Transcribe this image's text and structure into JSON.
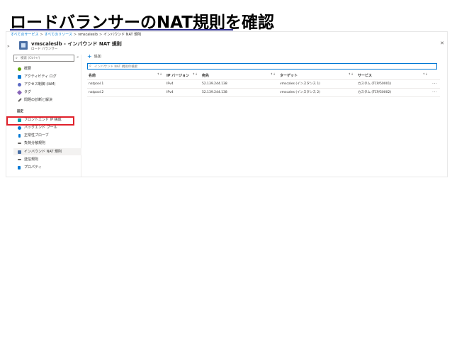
{
  "slide": {
    "title": "ロードバランサーのNAT規則を確認"
  },
  "breadcrumb": {
    "items": [
      "すべてのサービス",
      "すべてのリソース",
      "vmscaleslb",
      "インバウンド NAT 規則"
    ],
    "separator": ">"
  },
  "resource": {
    "title": "vmscaleslb - インバウンド NAT 規則",
    "subtitle": "ロード バランサー"
  },
  "sidebar": {
    "search_placeholder": "検索 (Ctrl+/)",
    "collapse_glyph": "«",
    "items": [
      {
        "label": "概要",
        "icon": "overview-icon",
        "color": "#5ba300"
      },
      {
        "label": "アクティビティ ログ",
        "icon": "activity-log-icon",
        "color": "#0078d4"
      },
      {
        "label": "アクセス制御 (IAM)",
        "icon": "iam-icon",
        "color": "#5c6ac4"
      },
      {
        "label": "タグ",
        "icon": "tag-icon",
        "color": "#8764b8"
      },
      {
        "label": "問題の診断と解決",
        "icon": "wrench-icon",
        "color": "#605e5c"
      }
    ],
    "section": "設定",
    "settings_items": [
      {
        "label": "フロントエンド IP 構成",
        "icon": "frontend-ip-icon",
        "color": "#00a2ad"
      },
      {
        "label": "バックエンド プール",
        "icon": "backend-pool-icon",
        "color": "#0078d4"
      },
      {
        "label": "正常性プローブ",
        "icon": "health-probe-icon",
        "color": "#0078d4"
      },
      {
        "label": "負荷分散規則",
        "icon": "lb-rules-icon",
        "color": "#605e5c"
      },
      {
        "label": "インバウンド NAT 規則",
        "icon": "inbound-nat-icon",
        "color": "#4a6fa5"
      },
      {
        "label": "送信規則",
        "icon": "outbound-rules-icon",
        "color": "#605e5c"
      },
      {
        "label": "プロパティ",
        "icon": "properties-icon",
        "color": "#0078d4"
      }
    ]
  },
  "toolbar": {
    "add_label": "追加"
  },
  "filter": {
    "placeholder": "インバウンド NAT 規則の検索"
  },
  "table": {
    "columns": [
      "名前",
      "IP バージョン",
      "宛先",
      "ターゲット",
      "サービス"
    ],
    "rows": [
      {
        "name": "natpool.1",
        "ip_version": "IPv4",
        "destination": "52.139.244.138",
        "target": "vmscales (インスタンス 1)",
        "service": "カスタム (TCP/50001)"
      },
      {
        "name": "natpool.2",
        "ip_version": "IPv4",
        "destination": "52.139.244.138",
        "target": "vmscales (インスタンス 2)",
        "service": "カスタム (TCP/50002)"
      }
    ]
  },
  "colors": {
    "accent": "#0078d4",
    "highlight": "#e0202a",
    "title_rule": "#2e2e8f"
  }
}
